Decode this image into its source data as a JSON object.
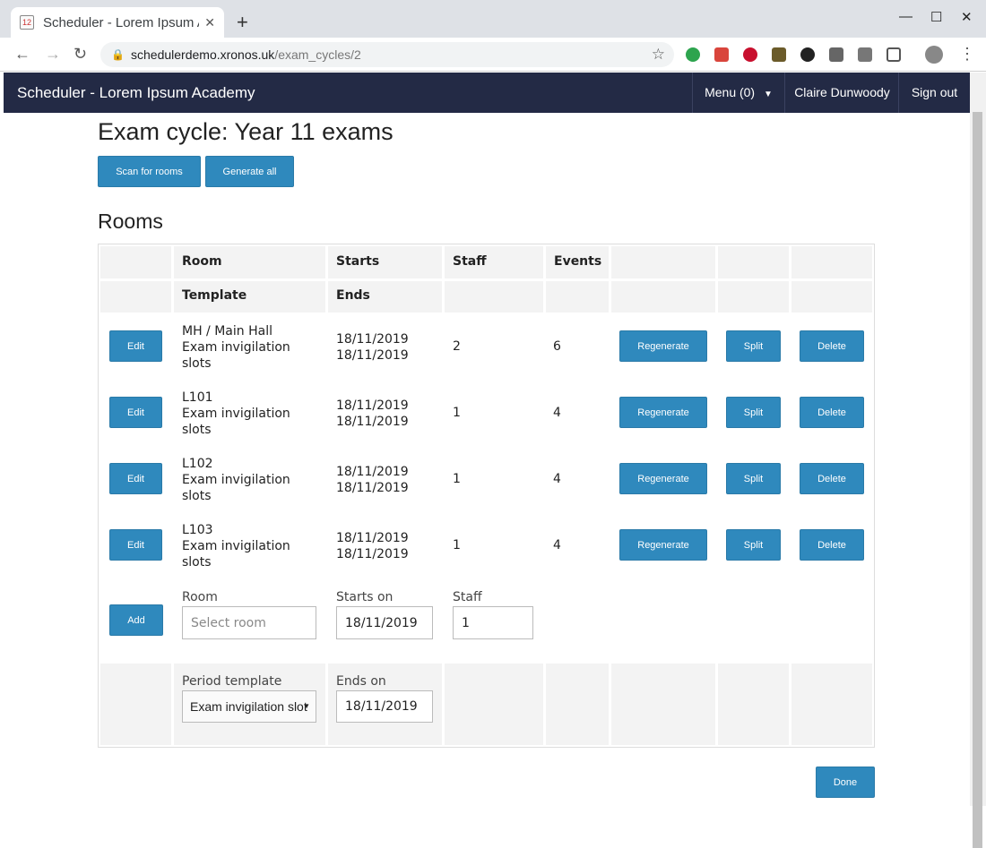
{
  "browser": {
    "tab_title": "Scheduler - Lorem Ipsum A",
    "url_host": "schedulerdemo.xronos.uk",
    "url_path": "/exam_cycles/2"
  },
  "app": {
    "brand": "Scheduler - Lorem Ipsum Academy",
    "menu": "Menu (0)",
    "user": "Claire Dunwoody",
    "signout": "Sign out"
  },
  "page": {
    "title": "Exam cycle: Year 11 exams",
    "scan_button": "Scan for rooms",
    "generate_button": "Generate all",
    "rooms_heading": "Rooms",
    "done_button": "Done"
  },
  "table": {
    "headers": {
      "room": "Room",
      "starts": "Starts",
      "staff": "Staff",
      "events": "Events",
      "template": "Template",
      "ends": "Ends"
    },
    "rows": [
      {
        "room": "MH / Main Hall",
        "template": "Exam invigilation slots",
        "starts": "18/11/2019",
        "ends": "18/11/2019",
        "staff": "2",
        "events": "6"
      },
      {
        "room": "L101",
        "template": "Exam invigilation slots",
        "starts": "18/11/2019",
        "ends": "18/11/2019",
        "staff": "1",
        "events": "4"
      },
      {
        "room": "L102",
        "template": "Exam invigilation slots",
        "starts": "18/11/2019",
        "ends": "18/11/2019",
        "staff": "1",
        "events": "4"
      },
      {
        "room": "L103",
        "template": "Exam invigilation slots",
        "starts": "18/11/2019",
        "ends": "18/11/2019",
        "staff": "1",
        "events": "4"
      }
    ],
    "row_buttons": {
      "edit": "Edit",
      "regenerate": "Regenerate",
      "split": "Split",
      "delete": "Delete"
    },
    "add_form": {
      "add_button": "Add",
      "room_label": "Room",
      "room_placeholder": "Select room",
      "starts_on_label": "Starts on",
      "starts_on_value": "18/11/2019",
      "staff_label": "Staff",
      "staff_value": "1",
      "template_label": "Period template",
      "template_value": "Exam invigilation slot",
      "ends_on_label": "Ends on",
      "ends_on_value": "18/11/2019"
    }
  },
  "colors": {
    "navbar": "#232a45",
    "button": "#2f89bd"
  }
}
